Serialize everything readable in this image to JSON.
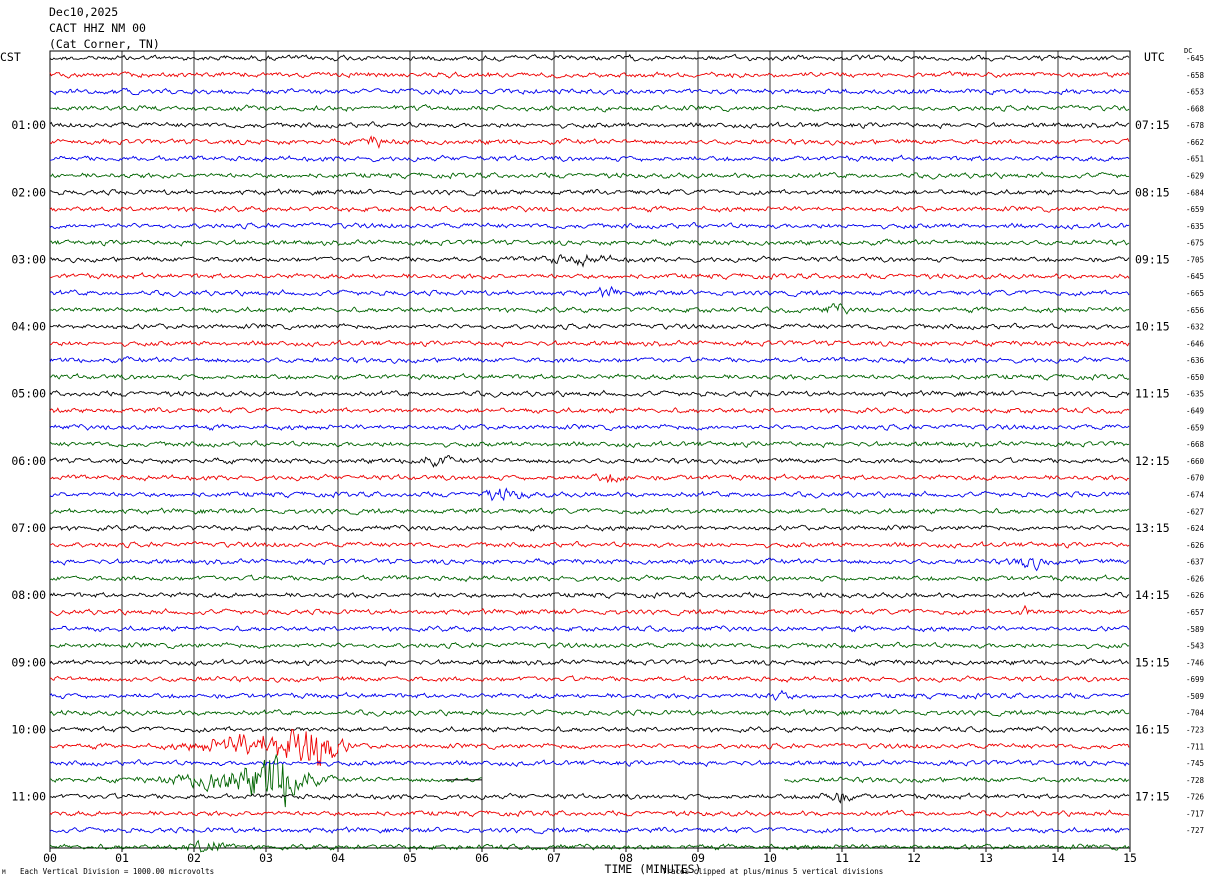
{
  "header": {
    "date": "Dec10,2025",
    "station": "CACT HHZ NM 00",
    "location": "(Cat Corner, TN)"
  },
  "labels": {
    "left_tz": "CST",
    "right_tz": "UTC",
    "dc": "DC"
  },
  "footer": {
    "left": "Each Vertical Division = 1000.00 microvolts",
    "right": "Traces clipped at plus/minus 5 vertical divisions",
    "tiny": "M"
  },
  "chart_data": {
    "type": "line",
    "subtype": "helicorder",
    "xlabel": "TIME (MINUTES)",
    "x_ticks": [
      "00",
      "01",
      "02",
      "03",
      "04",
      "05",
      "06",
      "07",
      "08",
      "09",
      "10",
      "11",
      "12",
      "13",
      "14",
      "15"
    ],
    "xlim": [
      0,
      15
    ],
    "row_minutes": 15,
    "rows": 48,
    "trace_colors": [
      "#000000",
      "#ee0000",
      "#0000ee",
      "#006400"
    ],
    "left_time_labels": [
      "01:00",
      "02:00",
      "03:00",
      "04:00",
      "05:00",
      "06:00",
      "07:00",
      "08:00",
      "09:00",
      "10:00",
      "11:00"
    ],
    "right_time_labels": [
      "07:15",
      "08:15",
      "09:15",
      "10:15",
      "11:15",
      "12:15",
      "13:15",
      "14:15",
      "15:15",
      "16:15",
      "17:15"
    ],
    "dc_offsets": [
      "-645",
      "-658",
      "-653",
      "-668",
      "-678",
      "-662",
      "-651",
      "-629",
      "-684",
      "-659",
      "-635",
      "-675",
      "-705",
      "-645",
      "-665",
      "-656",
      "-632",
      "-646",
      "-636",
      "-650",
      "-635",
      "-649",
      "-659",
      "-668",
      "-660",
      "-670",
      "-674",
      "-627",
      "-624",
      "-626",
      "-637",
      "-626",
      "-626",
      "-657",
      "-589",
      "-543",
      "-746",
      "-699",
      "-509",
      "-704",
      "-723",
      "-711",
      "-745",
      "-728",
      "-726",
      "-717",
      "-727"
    ],
    "events": [
      {
        "row": 5,
        "minute": 4.5,
        "amp": 1.5,
        "width": 0.2
      },
      {
        "row": 12,
        "minute": 7.3,
        "amp": 1.3,
        "width": 0.6
      },
      {
        "row": 14,
        "minute": 7.75,
        "amp": 1.6,
        "width": 0.15
      },
      {
        "row": 15,
        "minute": 10.9,
        "amp": 1.4,
        "width": 0.2
      },
      {
        "row": 24,
        "minute": 5.3,
        "amp": 1.3,
        "width": 0.3
      },
      {
        "row": 25,
        "minute": 7.8,
        "amp": 1.3,
        "width": 0.3
      },
      {
        "row": 26,
        "minute": 6.3,
        "amp": 1.8,
        "width": 0.35
      },
      {
        "row": 30,
        "minute": 13.6,
        "amp": 2.2,
        "width": 0.25
      },
      {
        "row": 33,
        "minute": 13.55,
        "amp": 2.0,
        "width": 0.1
      },
      {
        "row": 38,
        "minute": 10.1,
        "amp": 1.7,
        "width": 0.2
      },
      {
        "row": 41,
        "minute": 2.9,
        "amp": 4.5,
        "width": 0.9
      },
      {
        "row": 41,
        "minute": 3.7,
        "amp": 4.0,
        "width": 0.4
      },
      {
        "row": 43,
        "minute": 2.6,
        "amp": 4.5,
        "width": 0.9
      },
      {
        "row": 43,
        "minute": 3.3,
        "amp": 3.0,
        "width": 0.4
      },
      {
        "row": 44,
        "minute": 10.9,
        "amp": 1.8,
        "width": 0.3
      },
      {
        "row": 47,
        "minute": 2.2,
        "amp": 2.6,
        "width": 0.3
      }
    ],
    "gap": {
      "row": 43,
      "from": 6.0,
      "to": 10.2,
      "dash_from": 5.5,
      "dash_to": 6.0
    }
  }
}
